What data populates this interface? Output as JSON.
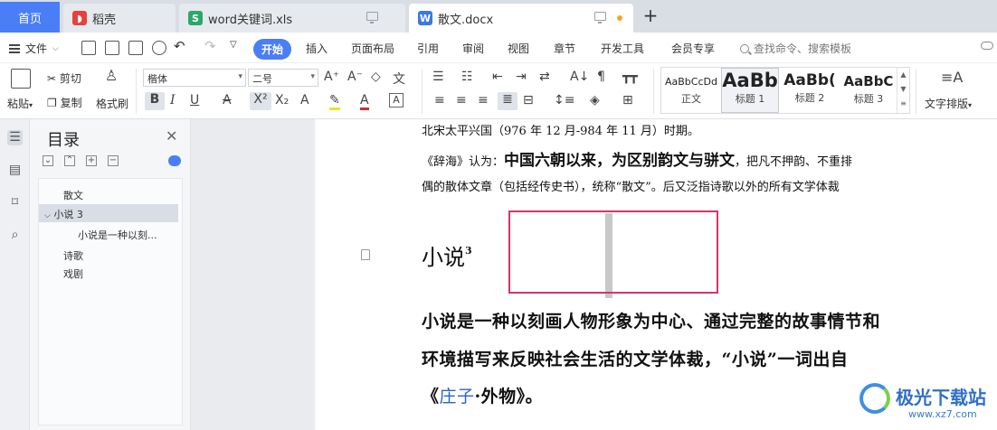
{
  "tabs": {
    "home": "首页",
    "daoke": "稻壳",
    "xls": "word关键词.xls",
    "docx": "散文.docx",
    "add": "+"
  },
  "menu": {
    "file": "文件",
    "items": [
      "开始",
      "插入",
      "页面布局",
      "引用",
      "审阅",
      "视图",
      "章节",
      "开发工具",
      "会员专享"
    ],
    "search_placeholder": "查找命令、搜索模板"
  },
  "ribbon": {
    "paste": "粘贴",
    "cut": "剪切",
    "copy": "复制",
    "format_painter": "格式刷",
    "font_name": "楷体",
    "font_size": "二号",
    "styles": [
      {
        "preview": "AaBbCcDd",
        "label": "正文"
      },
      {
        "preview": "AaBb",
        "label": "标题 1"
      },
      {
        "preview": "AaBb(",
        "label": "标题 2"
      },
      {
        "preview": "AaBbC",
        "label": "标题 3"
      }
    ],
    "text_layout": "文字排版"
  },
  "toc": {
    "title": "目录",
    "items": [
      {
        "label": "散文",
        "level": 1
      },
      {
        "label": "小说 3",
        "level": 1,
        "selected": true,
        "expanded": true
      },
      {
        "label": "小说是一种以刻...",
        "level": 2
      },
      {
        "label": "诗歌",
        "level": 1
      },
      {
        "label": "戏剧",
        "level": 1
      }
    ]
  },
  "document": {
    "line1": "北宋太平兴国（976 年 12 月-984 年 11 月）时期。",
    "line2_a": "《辞海》认为：",
    "line2_b": "中国六朝以来，为区别韵文与骈文",
    "line2_c": "，把凡不押韵、不重排",
    "line3": "偶的散体文章（包括经传史书），统称“散文”。后又泛指诗歌以外的所有文学体裁",
    "heading": "小说",
    "heading_sup": "3",
    "body1": "小说是一种以刻画人物形象为中心、通过完整的故事情节和",
    "body2": "环境描写来反映社会生活的文学体裁，“小说”一词出自",
    "body3_a": "《",
    "body3_b": "庄子",
    "body3_c": "·外物》。"
  },
  "watermark": {
    "name": "极光下载站",
    "url": "www.xz7.com"
  },
  "colors": {
    "accent": "#4a7ef7",
    "highlight_box": "#d6336c",
    "link_text": "#2a64c5"
  }
}
